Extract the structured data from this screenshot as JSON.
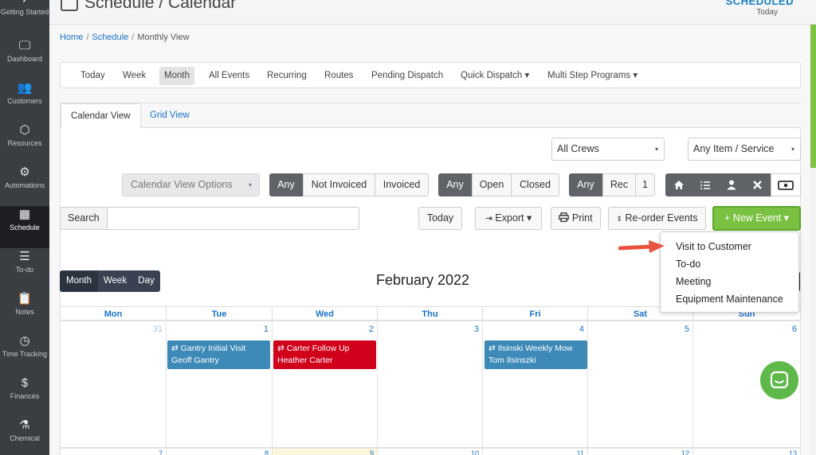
{
  "sidebar": {
    "items": [
      {
        "label": "Getting Started",
        "icon": "rocket-icon",
        "glyph": "✈"
      },
      {
        "label": "Dashboard",
        "icon": "monitor-icon",
        "glyph": "🖵"
      },
      {
        "label": "Customers",
        "icon": "users-icon",
        "glyph": "👥"
      },
      {
        "label": "Resources",
        "icon": "box-icon",
        "glyph": "⬡"
      },
      {
        "label": "Automations",
        "icon": "gears-icon",
        "glyph": "⚙"
      },
      {
        "label": "Schedule",
        "icon": "calendar-icon",
        "glyph": "▦"
      },
      {
        "label": "To-do",
        "icon": "checklist-icon",
        "glyph": "☰"
      },
      {
        "label": "Notes",
        "icon": "clipboard-icon",
        "glyph": "📋"
      },
      {
        "label": "Time Tracking",
        "icon": "clock-icon",
        "glyph": "◷"
      },
      {
        "label": "Finances",
        "icon": "dollar-icon",
        "glyph": "$"
      },
      {
        "label": "Chemical",
        "icon": "flask-icon",
        "glyph": "⚗"
      }
    ]
  },
  "header": {
    "title": "Schedule / Calendar",
    "status": "SCHEDULED",
    "status_sub": "Today"
  },
  "breadcrumb": {
    "home": "Home",
    "schedule": "Schedule",
    "current": "Monthly View",
    "sep": "/"
  },
  "subnav": {
    "items": [
      "Today",
      "Week",
      "Month",
      "All Events",
      "Recurring",
      "Routes",
      "Pending Dispatch",
      "Quick Dispatch ▾",
      "Multi Step Programs ▾"
    ]
  },
  "tabs": {
    "calendar": "Calendar View",
    "grid": "Grid View"
  },
  "filters": {
    "crews": "All Crews",
    "item_service": "Any Item / Service",
    "view_options": "Calendar View Options",
    "invoice": [
      "Any",
      "Not Invoiced",
      "Invoiced"
    ],
    "status": [
      "Any",
      "Open",
      "Closed"
    ],
    "recurring": [
      "Any",
      "Rec",
      "1"
    ],
    "caret": "▾"
  },
  "toolbar": {
    "search_label": "Search",
    "today": "Today",
    "export": "Export ▾",
    "print": "Print",
    "reorder": "Re-order Events",
    "new_event": "+ New Event ▾"
  },
  "view_switch": [
    "Month",
    "Week",
    "Day"
  ],
  "calendar": {
    "title": "February 2022",
    "days": [
      "Mon",
      "Tue",
      "Wed",
      "Thu",
      "Fri",
      "Sat",
      "Sun"
    ],
    "week1": [
      "31",
      "1",
      "2",
      "3",
      "4",
      "5",
      "6"
    ],
    "week2": [
      "7",
      "8",
      "9",
      "10",
      "11",
      "12",
      "13"
    ],
    "events": [
      {
        "line1": "⇄ Gantry Initial Visit",
        "line2": "Geoff Gantry",
        "color": "#3d8ab8"
      },
      {
        "line1": "⇄ Carter Follow Up",
        "line2": "Heather Carter",
        "color": "#d0021b"
      },
      {
        "line1": "⇄ Ilsinski Weekly Mow",
        "line2": "Tom Ilsinszki",
        "color": "#3d8ab8"
      }
    ]
  },
  "new_event_menu": [
    "Visit to Customer",
    "To-do",
    "Meeting",
    "Equipment Maintenance"
  ],
  "colors": {
    "accent": "#7ac142",
    "link": "#1a73c8",
    "sidebar": "#3a3d42",
    "arrow": "#e8533f"
  }
}
